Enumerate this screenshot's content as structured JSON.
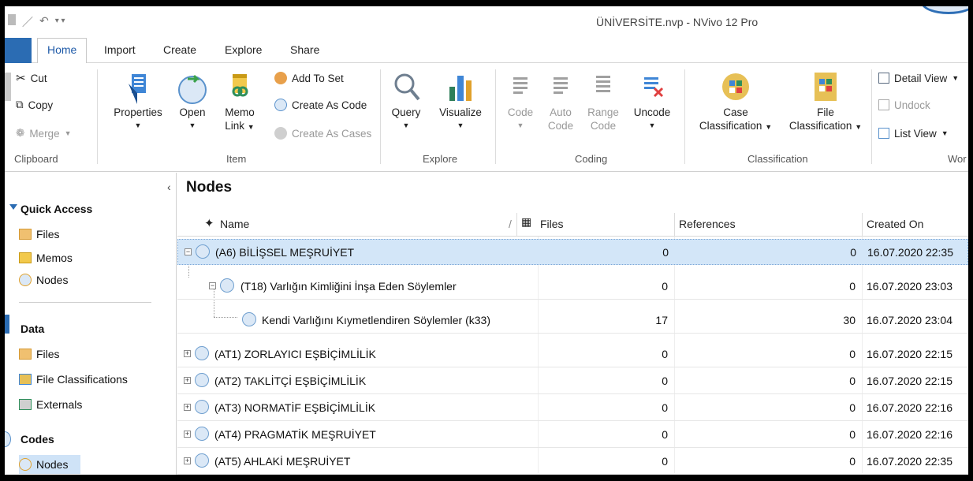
{
  "window": {
    "title": "ÜNİVERSİTE.nvp - NVivo 12 Pro"
  },
  "tabs": [
    "Home",
    "Import",
    "Create",
    "Explore",
    "Share"
  ],
  "ribbon": {
    "clipboard": {
      "cut": "Cut",
      "copy": "Copy",
      "merge": "Merge",
      "label": "Clipboard"
    },
    "item": {
      "properties": "Properties",
      "open": "Open",
      "memo_link_1": "Memo",
      "memo_link_2": "Link",
      "add_to_set": "Add To Set",
      "create_as_code": "Create As Code",
      "create_as_cases": "Create As Cases",
      "label": "Item"
    },
    "explore": {
      "query": "Query",
      "visualize": "Visualize",
      "label": "Explore"
    },
    "coding": {
      "code": "Code",
      "auto_code_1": "Auto",
      "auto_code_2": "Code",
      "range_code_1": "Range",
      "range_code_2": "Code",
      "uncode": "Uncode",
      "label": "Coding"
    },
    "classification": {
      "case_1": "Case",
      "case_2": "Classification",
      "file_1": "File",
      "file_2": "Classification",
      "label": "Classification"
    },
    "workspace": {
      "detail_view": "Detail View",
      "undock": "Undock",
      "list_view": "List View",
      "label": "Wor"
    }
  },
  "nav": {
    "quick_access": {
      "heading": "Quick Access",
      "items": [
        "Files",
        "Memos",
        "Nodes"
      ]
    },
    "data": {
      "heading": "Data",
      "items": [
        "Files",
        "File Classifications",
        "Externals"
      ]
    },
    "codes": {
      "heading": "Codes",
      "items": [
        "Nodes"
      ]
    }
  },
  "main": {
    "title": "Nodes",
    "columns": {
      "name": "Name",
      "files": "Files",
      "references": "References",
      "created_on": "Created On"
    },
    "rows": [
      {
        "name": "(A6) BİLİŞSEL MEŞRUİYET",
        "files": "0",
        "references": "0",
        "created": "16.07.2020 22:35"
      },
      {
        "name": "(T18) Varlığın Kimliğini İnşa Eden Söylemler",
        "files": "0",
        "references": "0",
        "created": "16.07.2020 23:03"
      },
      {
        "name": "Kendi Varlığını Kıymetlendiren Söylemler (k33)",
        "files": "17",
        "references": "30",
        "created": "16.07.2020 23:04"
      },
      {
        "name": "(AT1) ZORLAYICI EŞBİÇİMLİLİK",
        "files": "0",
        "references": "0",
        "created": "16.07.2020 22:15"
      },
      {
        "name": "(AT2) TAKLİTÇİ EŞBİÇİMLİLİK",
        "files": "0",
        "references": "0",
        "created": "16.07.2020 22:15"
      },
      {
        "name": "(AT3) NORMATİF EŞBİÇİMLİLİK",
        "files": "0",
        "references": "0",
        "created": "16.07.2020 22:16"
      },
      {
        "name": "(AT4) PRAGMATİK MEŞRUİYET",
        "files": "0",
        "references": "0",
        "created": "16.07.2020 22:16"
      },
      {
        "name": "(AT5) AHLAKİ MEŞRUİYET",
        "files": "0",
        "references": "0",
        "created": "16.07.2020 22:35"
      }
    ]
  }
}
